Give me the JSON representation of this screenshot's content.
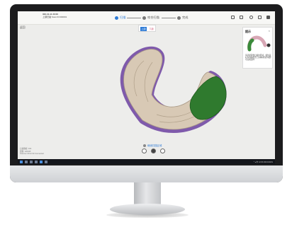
{
  "header": {
    "patient_line1": "000-10-11 20:00",
    "patient_line2": "上颌扫描 Scan ID:000001",
    "steps": [
      {
        "label": "扫描",
        "active": true
      },
      {
        "label": "咬合扫描",
        "active": false
      },
      {
        "label": "完成",
        "active": false
      }
    ]
  },
  "back_label": "返回",
  "view_toggle": {
    "left": "上颌",
    "right": "下颌"
  },
  "thumbnail_panel": {
    "title": "提示",
    "close": "×",
    "text": "请选择需要扫描的区域，按住鼠标左键在模型上涂抹绿色区域即可完成选择"
  },
  "bottom_left_info": [
    "扫描数据: 100",
    "面数: 120345",
    "Scanner 00:12:33 Connected"
  ],
  "hint_label": "继续扫描区域",
  "taskbar": {
    "tray_text": "^ ◂ 中 12:00 2021/10/11"
  },
  "colors": {
    "accent": "#2e7bd6",
    "selection_green": "#2f7a2e",
    "tooth": "#d8c9b5",
    "gum_edge": "#6b3fa0",
    "screen_bg": "#ededeb"
  },
  "icons": [
    "scan-step-icon",
    "bite-step-icon",
    "complete-step-icon",
    "settings-icon",
    "minimize-icon",
    "close-icon",
    "undo-icon",
    "record-icon",
    "next-icon"
  ]
}
